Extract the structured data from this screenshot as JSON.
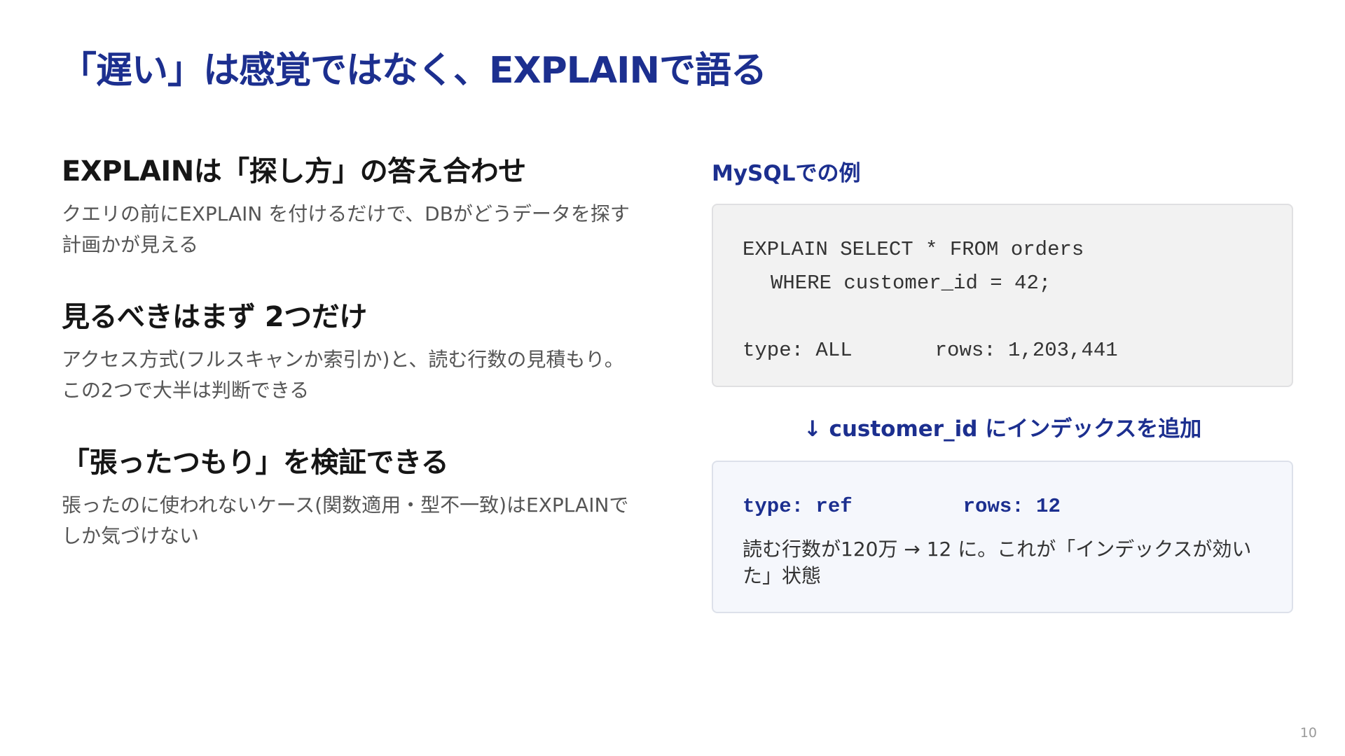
{
  "slide": {
    "title": "「遅い」は感覚ではなく、EXPLAINで語る",
    "page_number": "10"
  },
  "points": [
    {
      "heading": "EXPLAINは「探し方」の答え合わせ",
      "body": "クエリの前にEXPLAIN を付けるだけで、DBがどうデータを探す計画かが見える"
    },
    {
      "heading": "見るべきはまず 2つだけ",
      "body": "アクセス方式(フルスキャンか索引か)と、読む行数の見積もり。この2つで大半は判断できる"
    },
    {
      "heading": "「張ったつもり」を検証できる",
      "body": "張ったのに使われないケース(関数適用・型不一致)はEXPLAINでしか気づけない"
    }
  ],
  "example": {
    "label": "MySQLでの例",
    "code_line_1": "EXPLAIN SELECT * FROM orders",
    "code_line_2": "WHERE customer_id = 42;",
    "before_type": "type: ALL",
    "before_rows": "rows: 1,203,441",
    "arrow_note": "↓ customer_id にインデックスを追加",
    "after_type": "type: ref",
    "after_rows": "rows: 12",
    "after_desc": "読む行数が120万 → 12 に。これが「インデックスが効いた」状態"
  }
}
